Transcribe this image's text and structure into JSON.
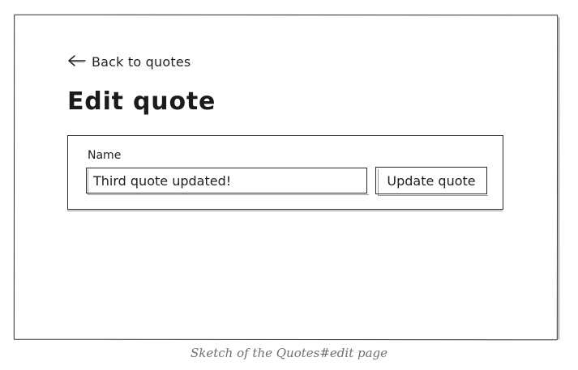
{
  "back_link": {
    "label": "Back to quotes",
    "icon": "arrow-left-icon"
  },
  "page": {
    "title": "Edit quote"
  },
  "form": {
    "field_label": "Name",
    "name_value": "Third quote updated!",
    "submit_label": "Update quote"
  },
  "caption": "Sketch of the Quotes#edit page"
}
